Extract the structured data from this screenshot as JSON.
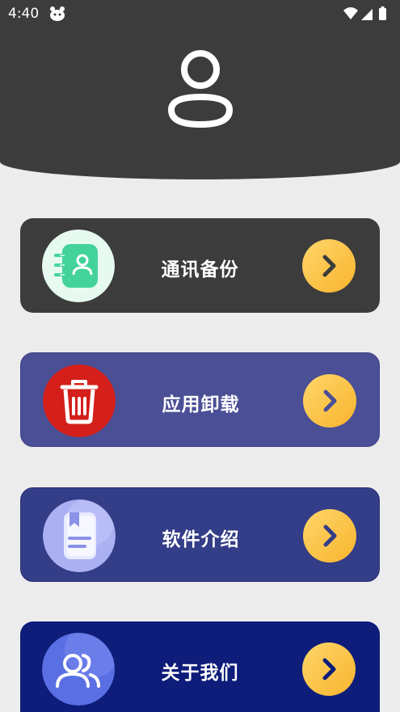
{
  "status_bar": {
    "time": "4:40"
  },
  "menu": {
    "items": [
      {
        "label": "通讯备份",
        "icon": "contacts-book-icon",
        "color": "#3c3c3c"
      },
      {
        "label": "应用卸载",
        "icon": "trash-icon",
        "color": "#4a4f96"
      },
      {
        "label": "软件介绍",
        "icon": "document-icon",
        "color": "#343d87"
      },
      {
        "label": "关于我们",
        "icon": "users-icon",
        "color": "#0e1d7a"
      }
    ]
  },
  "colors": {
    "header": "#3c3c3c",
    "accent": "#fbc140",
    "background": "#ececec"
  }
}
